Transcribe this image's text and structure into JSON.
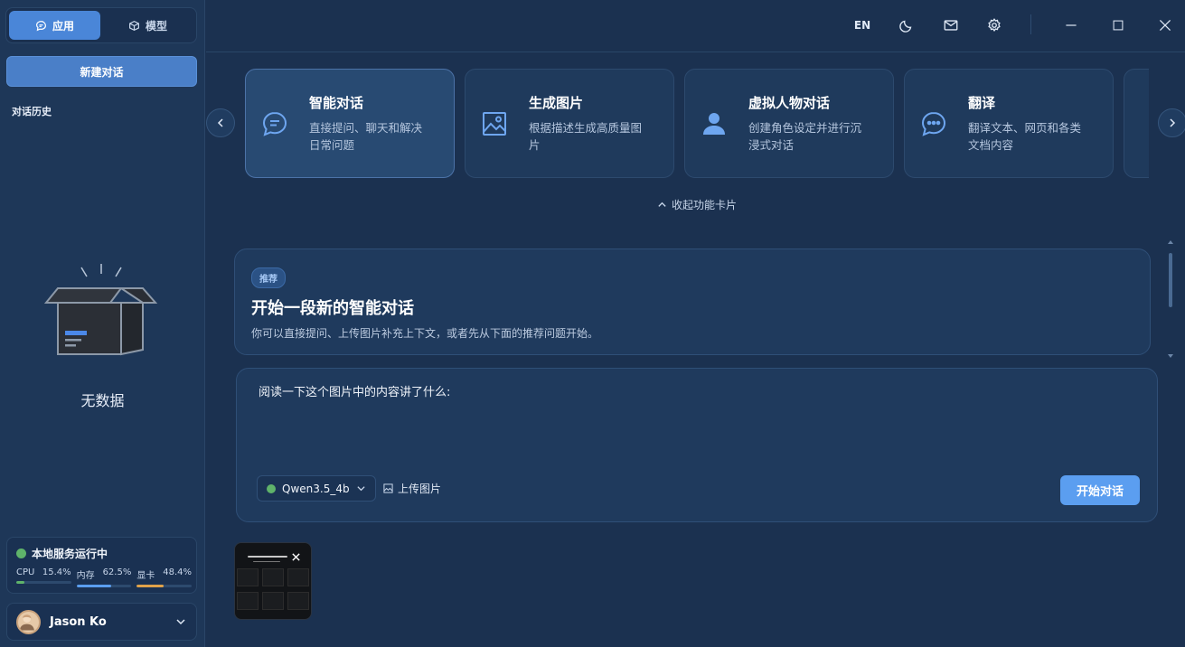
{
  "sidebar": {
    "tabs": [
      {
        "label": "应用",
        "icon": "chat-icon",
        "active": true
      },
      {
        "label": "模型",
        "icon": "box-icon",
        "active": false
      }
    ],
    "new_chat_label": "新建对话",
    "history_title": "对话历史",
    "empty_text": "无数据",
    "service": {
      "title": "本地服务运行中",
      "status_color": "#5fb36a",
      "metrics": [
        {
          "label": "CPU",
          "value": "15.4%",
          "fraction": 0.154,
          "color": "#5fb36a"
        },
        {
          "label": "内存",
          "value": "62.5%",
          "fraction": 0.625,
          "color": "#5b9ef0"
        },
        {
          "label": "显卡",
          "value": "48.4%",
          "fraction": 0.484,
          "color": "#e0a24a"
        }
      ]
    },
    "user": {
      "name": "Jason Ko"
    }
  },
  "topbar": {
    "lang": "EN",
    "icons": [
      "moon-icon",
      "mail-icon",
      "gear-icon",
      "minimize-icon",
      "maximize-icon",
      "close-icon"
    ]
  },
  "cards": [
    {
      "title": "智能对话",
      "desc": "直接提问、聊天和解决日常问题",
      "icon": "chat-bubble-icon",
      "active": true
    },
    {
      "title": "生成图片",
      "desc": "根据描述生成高质量图片",
      "icon": "image-icon",
      "active": false
    },
    {
      "title": "虚拟人物对话",
      "desc": "创建角色设定并进行沉浸式对话",
      "icon": "person-icon",
      "active": false
    },
    {
      "title": "翻译",
      "desc": "翻译文本、网页和各类文档内容",
      "icon": "dots-bubble-icon",
      "active": false
    }
  ],
  "collapse_label": "收起功能卡片",
  "recommend": {
    "badge": "推荐",
    "title": "开始一段新的智能对话",
    "desc": "你可以直接提问、上传图片补充上下文，或者先从下面的推荐问题开始。"
  },
  "input": {
    "prompt": "阅读一下这个图片中的内容讲了什么:",
    "model": "Qwen3.5_4b",
    "model_status_color": "#5fb36a",
    "upload_label": "上传图片",
    "start_label": "开始对话"
  },
  "attachment": {
    "close_icon": "close-icon"
  },
  "colors": {
    "accent": "#5b9ef0",
    "background": "#1b3150",
    "sidebar": "#1e3758"
  }
}
